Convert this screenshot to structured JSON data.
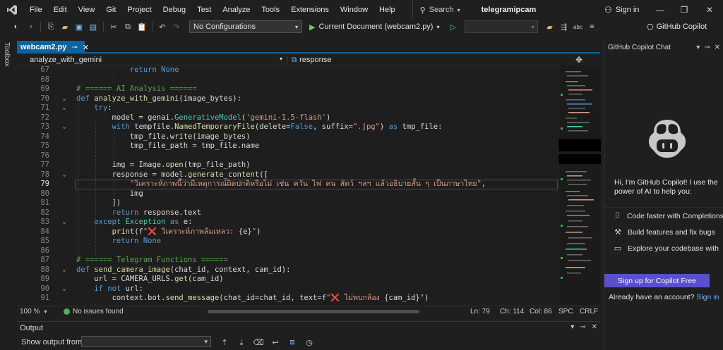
{
  "menubar": {
    "items": [
      "File",
      "Edit",
      "View",
      "Git",
      "Project",
      "Debug",
      "Test",
      "Analyze",
      "Tools",
      "Extensions",
      "Window",
      "Help"
    ],
    "search_label": "Search",
    "solution_name": "telegramipcam",
    "signin_label": "Sign in"
  },
  "toolbar": {
    "configuration": "No Configurations",
    "run_label": "Current Document (webcam2.py)",
    "copilot_label": "GitHub Copilot"
  },
  "toolbox": {
    "label": "Toolbox"
  },
  "editor": {
    "tab_label": "webcam2.py",
    "nav_left": "analyze_with_gemini",
    "nav_right": "response",
    "lines": [
      {
        "n": "67",
        "fold": "",
        "html": "            <span class=\"kw\">return</span> <span class=\"kw\">None</span>"
      },
      {
        "n": "68",
        "fold": "",
        "html": ""
      },
      {
        "n": "69",
        "fold": "",
        "html": "<span class=\"cmt\"># ====== AI Analysis ======</span>"
      },
      {
        "n": "70",
        "fold": "⌄",
        "html": "<span class=\"kw\">def</span> <span class=\"fn\">analyze_with_gemini</span>(image_bytes):"
      },
      {
        "n": "71",
        "fold": "⌄",
        "html": "    <span class=\"kw\">try</span>:"
      },
      {
        "n": "72",
        "fold": "",
        "html": "        model = genai.<span class=\"cls\">GenerativeModel</span>(<span class=\"str\">'gemini-1.5-flash'</span>)"
      },
      {
        "n": "73",
        "fold": "⌄",
        "html": "        <span class=\"kw\">with</span> tempfile.<span class=\"fn\">NamedTemporaryFile</span>(delete=<span class=\"kw\">False</span>, suffix=<span class=\"str\">\".jpg\"</span>) <span class=\"kw\">as</span> tmp_file:"
      },
      {
        "n": "74",
        "fold": "",
        "html": "            tmp_file.<span class=\"fn\">write</span>(image_bytes)"
      },
      {
        "n": "75",
        "fold": "",
        "html": "            tmp_file_path = tmp_file.name"
      },
      {
        "n": "76",
        "fold": "",
        "html": ""
      },
      {
        "n": "77",
        "fold": "",
        "html": "        img = Image.<span class=\"fn\">open</span>(tmp_file_path)"
      },
      {
        "n": "78",
        "fold": "⌄",
        "html": "        response = model.<span class=\"fn\">generate_content</span>(["
      },
      {
        "n": "79",
        "fold": "",
        "html": "            <span class=\"str\">\"วิเคราะห์ภาพนี้ว่ามีเหตุการณ์ผิดปกติหรือไม่ เช่น ควัน ไฟ คน สัตว์ ฯลฯ แล้วอธิบายสั้น ๆ เป็นภาษาไทย\"</span>,"
      },
      {
        "n": "80",
        "fold": "",
        "html": "            img"
      },
      {
        "n": "81",
        "fold": "",
        "html": "        ])"
      },
      {
        "n": "82",
        "fold": "",
        "html": "        <span class=\"kw\">return</span> response.text"
      },
      {
        "n": "83",
        "fold": "⌄",
        "html": "    <span class=\"kw\">except</span> <span class=\"cls\">Exception</span> <span class=\"kw\">as</span> e:"
      },
      {
        "n": "84",
        "fold": "",
        "html": "        <span class=\"fn\">print</span>(f<span class=\"str\">\"<span class=\"xmark\">❌</span> วิเคราะห์ภาพล้มเหลว: </span>{e}<span class=\"str\">\"</span>)"
      },
      {
        "n": "85",
        "fold": "",
        "html": "        <span class=\"kw\">return</span> <span class=\"kw\">None</span>"
      },
      {
        "n": "86",
        "fold": "",
        "html": ""
      },
      {
        "n": "87",
        "fold": "",
        "html": "<span class=\"cmt\"># ====== Telegram Functions ======</span>"
      },
      {
        "n": "88",
        "fold": "⌄",
        "html": "<span class=\"kw\">def</span> <span class=\"fn\">send_camera_image</span>(chat_id, context, cam_id):"
      },
      {
        "n": "89",
        "fold": "",
        "html": "    url = CAMERA_URLS.<span class=\"fn\">get</span>(cam_id)"
      },
      {
        "n": "90",
        "fold": "⌄",
        "html": "    <span class=\"kw\">if</span> <span class=\"kw\">not</span> url:"
      },
      {
        "n": "91",
        "fold": "",
        "html": "        context.bot.<span class=\"fn\">send_message</span>(chat_id=chat_id, text=f<span class=\"str\">\"<span class=\"xmark\">❌</span> ไม่พบกล้อง </span>{cam_id}<span class=\"str\">\"</span>)"
      }
    ],
    "current_line": "79"
  },
  "status": {
    "zoom": "100 %",
    "issues": "No issues found",
    "ln": "Ln: 79",
    "ch": "Ch: 114",
    "col": "Col: 86",
    "spc": "SPC",
    "crlf": "CRLF"
  },
  "output": {
    "title": "Output",
    "show_from_label": "Show output from:"
  },
  "copilot": {
    "panel_title": "GitHub Copilot Chat",
    "greeting": "Hi, I'm GitHub Copilot! I use the power of AI to help you:",
    "features": [
      {
        "icon": "code-icon",
        "label": "Code faster with Completions"
      },
      {
        "icon": "build-icon",
        "label": "Build features and fix bugs"
      },
      {
        "icon": "chat-icon",
        "label": "Explore your codebase with"
      }
    ],
    "signup_label": "Sign up for Copilot Free",
    "account_prefix": "Already have an account?",
    "account_link": "Sign in"
  },
  "colors": {
    "accent": "#0e639c",
    "copilot_button": "#5a4fcf",
    "editor_bg": "#1e1e1e"
  }
}
